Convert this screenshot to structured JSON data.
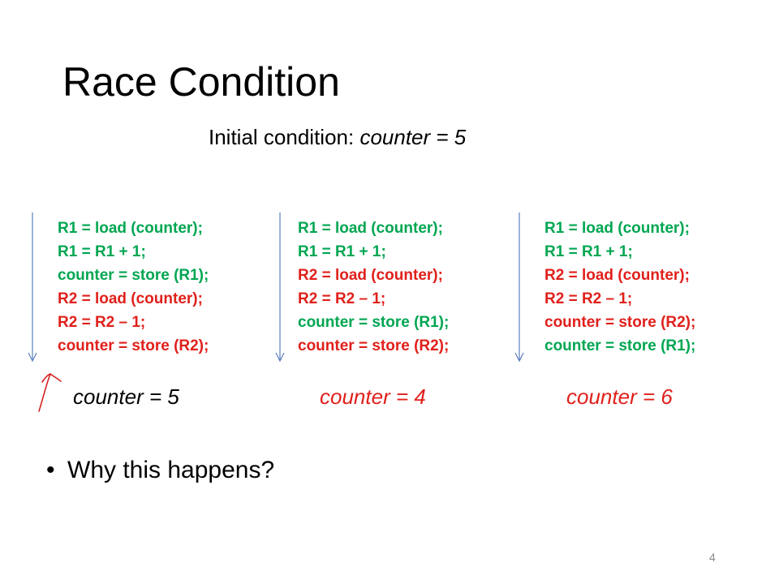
{
  "slide": {
    "title": "Race Condition",
    "initial": {
      "label": "Initial condition: ",
      "value": "counter = 5"
    },
    "columns": [
      {
        "lines": [
          {
            "text": "R1 = load (counter);",
            "color": "green"
          },
          {
            "text": "R1 = R1 + 1;",
            "color": "green"
          },
          {
            "text": "counter = store (R1);",
            "color": "green"
          },
          {
            "text": "R2 = load (counter);",
            "color": "red"
          },
          {
            "text": "R2 = R2 – 1;",
            "color": "red"
          },
          {
            "text": "counter = store (R2);",
            "color": "red"
          }
        ],
        "result": "counter = 5",
        "result_color": "black"
      },
      {
        "lines": [
          {
            "text": "R1 = load (counter);",
            "color": "green"
          },
          {
            "text": "R1 = R1 + 1;",
            "color": "green"
          },
          {
            "text": "R2 = load (counter);",
            "color": "red"
          },
          {
            "text": "R2 = R2 – 1;",
            "color": "red"
          },
          {
            "text": "counter = store (R1);",
            "color": "green"
          },
          {
            "text": "counter = store (R2);",
            "color": "red"
          }
        ],
        "result": "counter = 4",
        "result_color": "red"
      },
      {
        "lines": [
          {
            "text": "R1 = load (counter);",
            "color": "green"
          },
          {
            "text": "R1 = R1 + 1;",
            "color": "green"
          },
          {
            "text": "R2 = load (counter);",
            "color": "red"
          },
          {
            "text": "R2 = R2 – 1;",
            "color": "red"
          },
          {
            "text": "counter = store (R2);",
            "color": "red"
          },
          {
            "text": "counter = store (R1);",
            "color": "green"
          }
        ],
        "result": "counter = 6",
        "result_color": "red"
      }
    ],
    "bullet": "Why this happens?",
    "page_number": "4",
    "colors": {
      "green": "#00a651",
      "red": "#e0201b",
      "arrow": "#5b7fbf",
      "annotation": "#d42020"
    }
  }
}
